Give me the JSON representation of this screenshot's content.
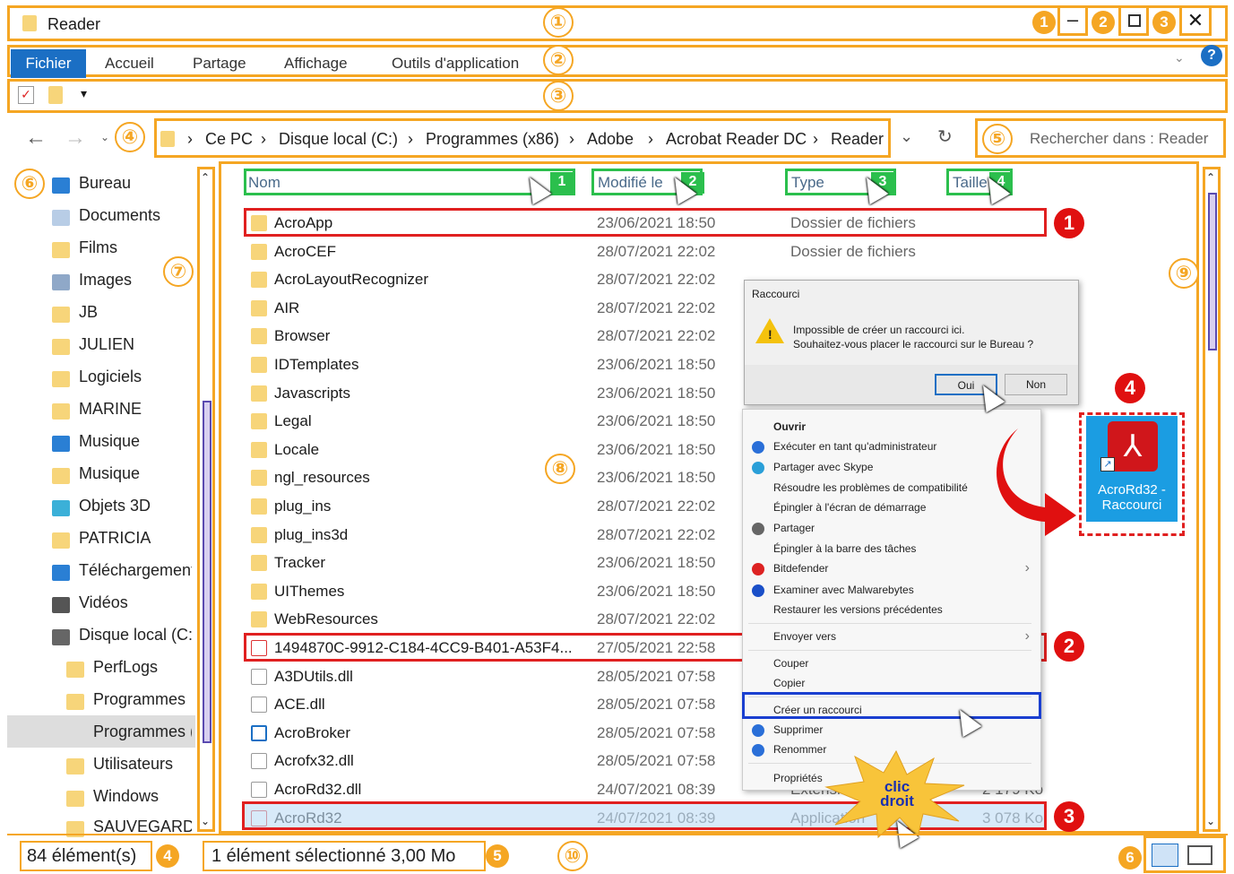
{
  "window": {
    "title": "Reader",
    "callouts": [
      "1",
      "2",
      "3"
    ]
  },
  "ribbon": {
    "tabs": [
      "Fichier",
      "Accueil",
      "Partage",
      "Affichage",
      "Outils d'application"
    ]
  },
  "address": {
    "segments": [
      "Ce PC",
      "Disque local (C:)",
      "Programmes (x86)",
      "Adobe",
      "Acrobat Reader DC",
      "Reader"
    ]
  },
  "search": {
    "placeholder": "Rechercher dans : Reader"
  },
  "columns": {
    "name": "Nom",
    "modified": "Modifié le",
    "type": "Type",
    "size": "Taille",
    "numbers": [
      "1",
      "2",
      "3",
      "4"
    ]
  },
  "nav_items": [
    "Bureau",
    "Documents",
    "Films",
    "Images",
    "JB",
    "JULIEN",
    "Logiciels",
    "MARINE",
    "Musique",
    "Musique",
    "Objets 3D",
    "PATRICIA",
    "Téléchargements",
    "Vidéos",
    "Disque local (C:)",
    "PerfLogs",
    "Programmes",
    "Programmes (x",
    "Utilisateurs",
    "Windows",
    "SAUVEGARDES ("
  ],
  "files": [
    {
      "name": "AcroApp",
      "date": "23/06/2021 18:50",
      "type": "Dossier de fichiers",
      "size": "",
      "kind": "folder"
    },
    {
      "name": "AcroCEF",
      "date": "28/07/2021 22:02",
      "type": "Dossier de fichiers",
      "size": "",
      "kind": "folder"
    },
    {
      "name": "AcroLayoutRecognizer",
      "date": "28/07/2021 22:02",
      "type": "",
      "size": "",
      "kind": "folder"
    },
    {
      "name": "AIR",
      "date": "28/07/2021 22:02",
      "type": "",
      "size": "",
      "kind": "folder"
    },
    {
      "name": "Browser",
      "date": "28/07/2021 22:02",
      "type": "",
      "size": "",
      "kind": "folder"
    },
    {
      "name": "IDTemplates",
      "date": "23/06/2021 18:50",
      "type": "",
      "size": "",
      "kind": "folder"
    },
    {
      "name": "Javascripts",
      "date": "23/06/2021 18:50",
      "type": "",
      "size": "",
      "kind": "folder"
    },
    {
      "name": "Legal",
      "date": "23/06/2021 18:50",
      "type": "",
      "size": "",
      "kind": "folder"
    },
    {
      "name": "Locale",
      "date": "23/06/2021 18:50",
      "type": "",
      "size": "",
      "kind": "folder"
    },
    {
      "name": "ngl_resources",
      "date": "23/06/2021 18:50",
      "type": "",
      "size": "",
      "kind": "folder"
    },
    {
      "name": "plug_ins",
      "date": "28/07/2021 22:02",
      "type": "",
      "size": "",
      "kind": "folder"
    },
    {
      "name": "plug_ins3d",
      "date": "28/07/2021 22:02",
      "type": "",
      "size": "",
      "kind": "folder"
    },
    {
      "name": "Tracker",
      "date": "23/06/2021 18:50",
      "type": "",
      "size": "",
      "kind": "folder"
    },
    {
      "name": "UIThemes",
      "date": "23/06/2021 18:50",
      "type": "",
      "size": "",
      "kind": "folder"
    },
    {
      "name": "WebResources",
      "date": "28/07/2021 22:02",
      "type": "",
      "size": "",
      "kind": "folder"
    },
    {
      "name": "1494870C-9912-C184-4CC9-B401-A53F4...",
      "date": "27/05/2021 22:58",
      "type": "",
      "size": "",
      "kind": "pdf"
    },
    {
      "name": "A3DUtils.dll",
      "date": "28/05/2021 07:58",
      "type": "",
      "size": "",
      "kind": "file"
    },
    {
      "name": "ACE.dll",
      "date": "28/05/2021 07:58",
      "type": "",
      "size": "",
      "kind": "file"
    },
    {
      "name": "AcroBroker",
      "date": "28/05/2021 07:58",
      "type": "",
      "size": "",
      "kind": "exe"
    },
    {
      "name": "Acrofx32.dll",
      "date": "28/05/2021 07:58",
      "type": "",
      "size": "",
      "kind": "file"
    },
    {
      "name": "AcroRd32.dll",
      "date": "24/07/2021 08:39",
      "type": "Extension de l'a...",
      "size": "2 179 Ko",
      "kind": "file"
    },
    {
      "name": "AcroRd32",
      "date": "24/07/2021 08:39",
      "type": "Application",
      "size": "3 078 Ko",
      "kind": "pdf"
    }
  ],
  "dialog": {
    "title": "Raccourci",
    "line1": "Impossible de créer un raccourci ici.",
    "line2": "Souhaitez-vous placer le raccourci sur le Bureau ?",
    "yes": "Oui",
    "no": "Non"
  },
  "context_menu": [
    "Ouvrir",
    "Exécuter en tant qu'administrateur",
    "Partager avec Skype",
    "Résoudre les problèmes de compatibilité",
    "Épingler à l'écran de démarrage",
    "Partager",
    "Épingler à la barre des tâches",
    "Bitdefender",
    "Examiner avec Malwarebytes",
    "Restaurer les versions précédentes",
    "Envoyer vers",
    "Couper",
    "Copier",
    "Créer un raccourci",
    "Supprimer",
    "Renommer",
    "Propriétés"
  ],
  "shortcut": {
    "label1": "AcroRd32 -",
    "label2": "Raccourci"
  },
  "burst": {
    "line1": "clic",
    "line2": "droit"
  },
  "status": {
    "count": "84 élément(s)",
    "selection": "1 élément sélectionné  3,00 Mo"
  },
  "callouts": {
    "orange": [
      "①",
      "②",
      "③",
      "④",
      "⑤",
      "⑥",
      "⑦",
      "⑧",
      "⑨",
      "⑩"
    ],
    "red": [
      "1",
      "2",
      "3",
      "4"
    ],
    "status": [
      "4",
      "5",
      "6"
    ]
  },
  "colors": {
    "orange": "#f5a623",
    "green": "#2bbf4d",
    "red": "#e02020",
    "blue": "#1b6fc4",
    "purple": "#5a4ab0"
  }
}
